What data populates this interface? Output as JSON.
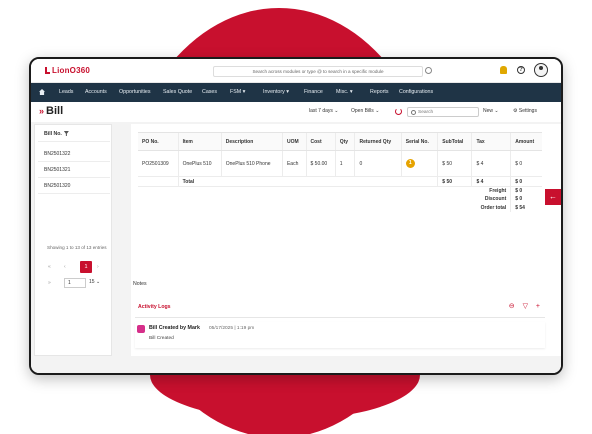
{
  "header": {
    "logo": "LionO360",
    "search_placeholder": "Search across modules or type @ to search in a specific module",
    "bell_icon": "bell-icon",
    "help_icon": "help-icon"
  },
  "nav": {
    "items": [
      "Leads",
      "Accounts",
      "Opportunities",
      "Sales Quote",
      "Cases",
      "FSM ▾",
      "Inventory ▾",
      "Finance",
      "Misc. ▾",
      "Reports",
      "Configurations"
    ]
  },
  "page": {
    "title": "Bill",
    "range": "last 7 days",
    "range_caret": "⌄",
    "filter": "Open Bills",
    "filter_caret": "⌄",
    "search_placeholder": "Search",
    "new_label": "New",
    "new_caret": "⌄",
    "settings_label": "⚙ Settings"
  },
  "left": {
    "header": "Bill No.",
    "items": [
      "BN2501322",
      "BN2501321",
      "BN2501320"
    ],
    "showing": "Showing 1 to 13 of 13 entries",
    "first": "«",
    "prev": "‹",
    "current_page": "1",
    "next": "›",
    "last": "»",
    "page_input": "1",
    "page_size": "15 ⌄"
  },
  "table": {
    "headers": [
      "PO No.",
      "Item",
      "Description",
      "UOM",
      "Cost",
      "Qty",
      "Returned Qty",
      "Serial No.",
      "SubTotal",
      "Tax",
      "Amount"
    ],
    "row": [
      "PO2501309",
      "OnePlus 510",
      "OnePlus 510 Phone",
      "Each",
      "$ 50.00",
      "1",
      "0",
      "1",
      "$ 50",
      "$ 4",
      "$ 0"
    ],
    "total_label": "Total",
    "total_subtotal": "$ 50",
    "total_tax": "$ 4",
    "total_amount": "$ 0",
    "summary": [
      {
        "label": "Freight",
        "value": "$ 0"
      },
      {
        "label": "Discount",
        "value": "$ 0"
      },
      {
        "label": "Order total",
        "value": "$ 54"
      }
    ]
  },
  "notes": {
    "label": "Notes"
  },
  "activity": {
    "title": "Activity Logs",
    "icons": "⊖ ▽ +",
    "entry_title": "Bill Created by Mark",
    "entry_date": "05/17/2025 | 1:19 pm",
    "entry_desc": "Bill Created"
  },
  "side_tab": {
    "icon": "←"
  },
  "colors": {
    "accent": "#c8102e",
    "nav_bg": "#1f3446"
  }
}
